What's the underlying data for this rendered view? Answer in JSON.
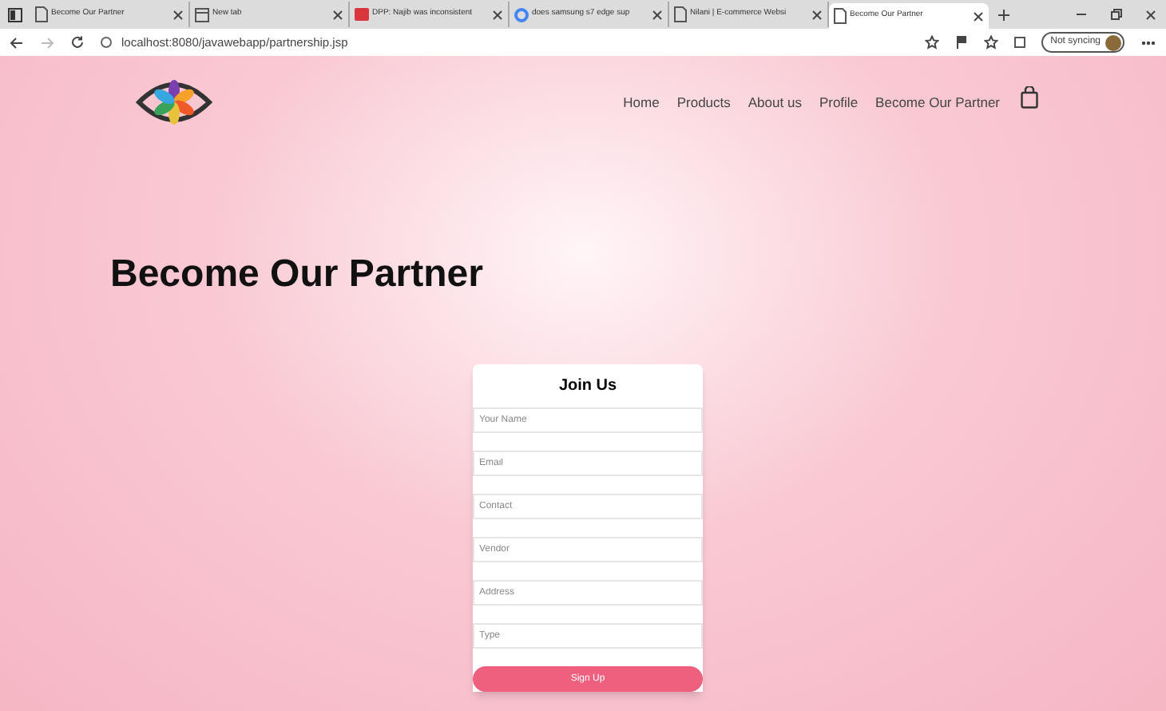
{
  "browser": {
    "tabs": [
      {
        "title": "Become Our Partner",
        "selected": false,
        "kind": "page"
      },
      {
        "title": "New tab",
        "selected": false,
        "kind": "newtab"
      },
      {
        "title": "DPP: Najib was inconsistent",
        "selected": false,
        "kind": "news"
      },
      {
        "title": "does samsung s7 edge sup",
        "selected": false,
        "kind": "search"
      },
      {
        "title": "Nilani | E-commerce Websi",
        "selected": false,
        "kind": "page"
      },
      {
        "title": "Become Our Partner",
        "selected": true,
        "kind": "page"
      }
    ],
    "address": "localhost:8080/javawebapp/partnership.jsp",
    "sync": "Not syncing"
  },
  "nav": {
    "links": [
      "Home",
      "Products",
      "About us",
      "Profile",
      "Become Our Partner"
    ]
  },
  "heading": "Become Our Partner",
  "form": {
    "title": "Join Us",
    "fields": [
      {
        "placeholder": "Your Name"
      },
      {
        "placeholder": "Email"
      },
      {
        "placeholder": "Contact"
      },
      {
        "placeholder": "Vendor"
      },
      {
        "placeholder": "Address"
      },
      {
        "placeholder": "Type"
      }
    ],
    "button": "Sign Up"
  }
}
